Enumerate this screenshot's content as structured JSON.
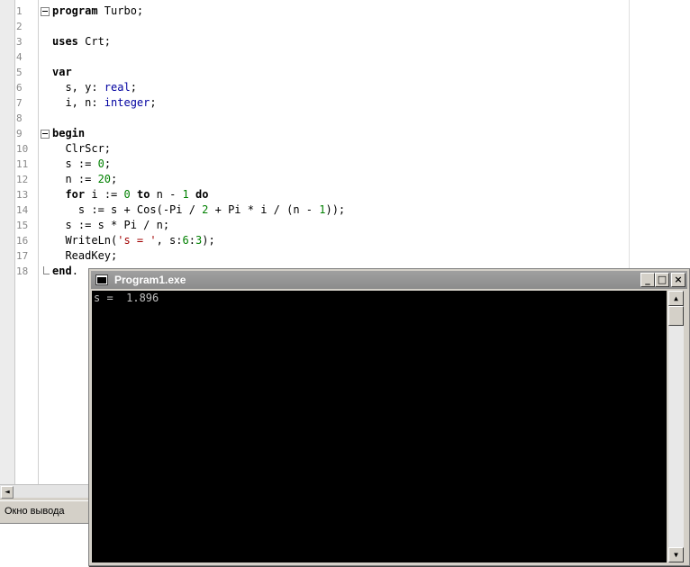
{
  "editor": {
    "lines": [
      {
        "n": "1",
        "html": "<span class='kw'>program</span> Turbo;"
      },
      {
        "n": "2",
        "html": ""
      },
      {
        "n": "3",
        "html": "<span class='kw'>uses</span> Crt;"
      },
      {
        "n": "4",
        "html": ""
      },
      {
        "n": "5",
        "html": "<span class='kw'>var</span>"
      },
      {
        "n": "6",
        "html": "  s, y: <span class='type'>real</span>;"
      },
      {
        "n": "7",
        "html": "  i, n: <span class='type'>integer</span>;"
      },
      {
        "n": "8",
        "html": ""
      },
      {
        "n": "9",
        "html": "<span class='kw'>begin</span>"
      },
      {
        "n": "10",
        "html": "  ClrScr;"
      },
      {
        "n": "11",
        "html": "  s := <span class='num'>0</span>;"
      },
      {
        "n": "12",
        "html": "  n := <span class='num'>20</span>;"
      },
      {
        "n": "13",
        "html": "  <span class='kw'>for</span> i := <span class='num'>0</span> <span class='kw'>to</span> n - <span class='num'>1</span> <span class='kw'>do</span>"
      },
      {
        "n": "14",
        "html": "    s := s + Cos(-Pi / <span class='num'>2</span> + Pi * i / (n - <span class='num'>1</span>));"
      },
      {
        "n": "15",
        "html": "  s := s * Pi / n;"
      },
      {
        "n": "16",
        "html": "  WriteLn(<span class='str'>'s = '</span>, s:<span class='num'>6</span>:<span class='num'>3</span>);"
      },
      {
        "n": "17",
        "html": "  ReadKey;"
      },
      {
        "n": "18",
        "html": "<span class='kw'>end</span>."
      }
    ]
  },
  "output_pane": {
    "title": "Окно вывода"
  },
  "console": {
    "title": "Program1.exe",
    "output": "s =  1.896",
    "buttons": {
      "minimize": "_",
      "maximize": "□",
      "close": "×"
    }
  },
  "scroll": {
    "left_arrow": "◄",
    "up_arrow": "▲",
    "down_arrow": "▼"
  }
}
